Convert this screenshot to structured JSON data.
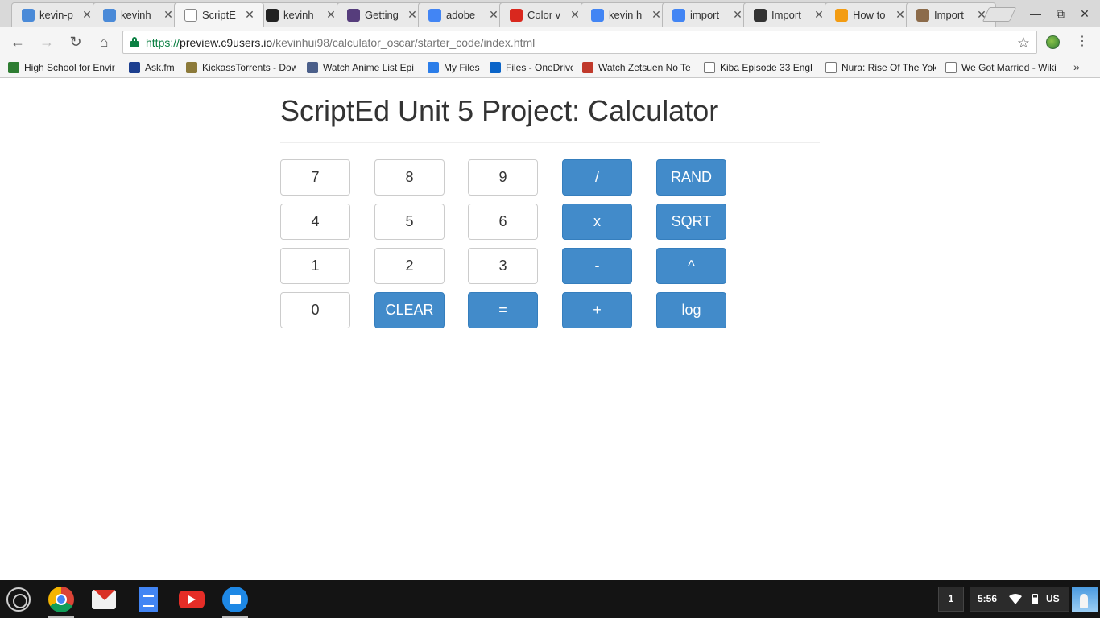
{
  "browser": {
    "tabs": [
      {
        "title": "kevin-p",
        "icon": "cloud9-icon",
        "icon_color": "#4a8ad8",
        "active": false
      },
      {
        "title": "kevinh",
        "icon": "cloud9-icon",
        "icon_color": "#4a8ad8",
        "active": false
      },
      {
        "title": "ScriptE",
        "icon": "page-icon",
        "icon_color": "#ffffff",
        "active": true
      },
      {
        "title": "kevinh",
        "icon": "github-icon",
        "icon_color": "#222222",
        "active": false
      },
      {
        "title": "Getting",
        "icon": "bootstrap-icon",
        "icon_color": "#563d7c",
        "active": false
      },
      {
        "title": "adobe",
        "icon": "google-icon",
        "icon_color": "#4285f4",
        "active": false
      },
      {
        "title": "Color v",
        "icon": "adobe-icon",
        "icon_color": "#d9281e",
        "active": false
      },
      {
        "title": "kevin h",
        "icon": "google-icon",
        "icon_color": "#4285f4",
        "active": false
      },
      {
        "title": "import",
        "icon": "google-icon",
        "icon_color": "#4285f4",
        "active": false
      },
      {
        "title": "Import",
        "icon": "site-icon",
        "icon_color": "#333333",
        "active": false
      },
      {
        "title": "How to",
        "icon": "sitepoint-icon",
        "icon_color": "#f39c12",
        "active": false
      },
      {
        "title": "Import",
        "icon": "mailchimp-icon",
        "icon_color": "#8c6b4a",
        "active": false
      }
    ],
    "close_glyph": "✕",
    "url": {
      "scheme": "https://",
      "host": "preview.c9users.io",
      "path": "/kevinhui98/calculator_oscar/starter_code/index.html"
    },
    "bookmarks": [
      {
        "label": "High School for Envir",
        "icon": "school-icon",
        "icon_color": "#2e7d32"
      },
      {
        "label": "Ask.fm",
        "icon": "askfm-icon",
        "icon_color": "#1d3f8f"
      },
      {
        "label": "KickassTorrents - Dow",
        "icon": "kickass-icon",
        "icon_color": "#8c7a3a"
      },
      {
        "label": "Watch Anime List Epi",
        "icon": "anime-icon",
        "icon_color": "#4b5f8a"
      },
      {
        "label": "My Files",
        "icon": "cloud-icon",
        "icon_color": "#2b7de9"
      },
      {
        "label": "Files - OneDrive",
        "icon": "onedrive-icon",
        "icon_color": "#0a64c8"
      },
      {
        "label": "Watch Zetsuen No Te",
        "icon": "zetsuen-icon",
        "icon_color": "#c0392b"
      },
      {
        "label": "Kiba Episode 33 Engl",
        "icon": "page-icon",
        "icon_color": "#ffffff"
      },
      {
        "label": "Nura: Rise Of The Yok",
        "icon": "page-icon",
        "icon_color": "#ffffff"
      },
      {
        "label": "We Got Married - Wiki",
        "icon": "wikipedia-icon",
        "icon_color": "#ffffff"
      }
    ],
    "overflow_glyph": "»"
  },
  "page": {
    "title": "ScriptEd Unit 5 Project: Calculator",
    "rows": [
      [
        {
          "label": "7",
          "style": "default"
        },
        {
          "label": "8",
          "style": "default"
        },
        {
          "label": "9",
          "style": "default"
        },
        {
          "label": "/",
          "style": "primary"
        },
        {
          "label": "RAND",
          "style": "primary"
        }
      ],
      [
        {
          "label": "4",
          "style": "default"
        },
        {
          "label": "5",
          "style": "default"
        },
        {
          "label": "6",
          "style": "default"
        },
        {
          "label": "x",
          "style": "primary"
        },
        {
          "label": "SQRT",
          "style": "primary"
        }
      ],
      [
        {
          "label": "1",
          "style": "default"
        },
        {
          "label": "2",
          "style": "default"
        },
        {
          "label": "3",
          "style": "default"
        },
        {
          "label": "-",
          "style": "primary"
        },
        {
          "label": "^",
          "style": "primary"
        }
      ],
      [
        {
          "label": "0",
          "style": "default"
        },
        {
          "label": "CLEAR",
          "style": "primary"
        },
        {
          "label": "=",
          "style": "primary"
        },
        {
          "label": "+",
          "style": "primary"
        },
        {
          "label": "log",
          "style": "primary"
        }
      ]
    ],
    "colors": {
      "primary": "#428bca",
      "default_border": "#cccccc"
    }
  },
  "shelf": {
    "apps": [
      "chrome-icon",
      "gmail-icon",
      "docs-icon",
      "youtube-icon",
      "files-icon"
    ],
    "notification_count": "1",
    "time": "5:56",
    "ime": "US"
  }
}
